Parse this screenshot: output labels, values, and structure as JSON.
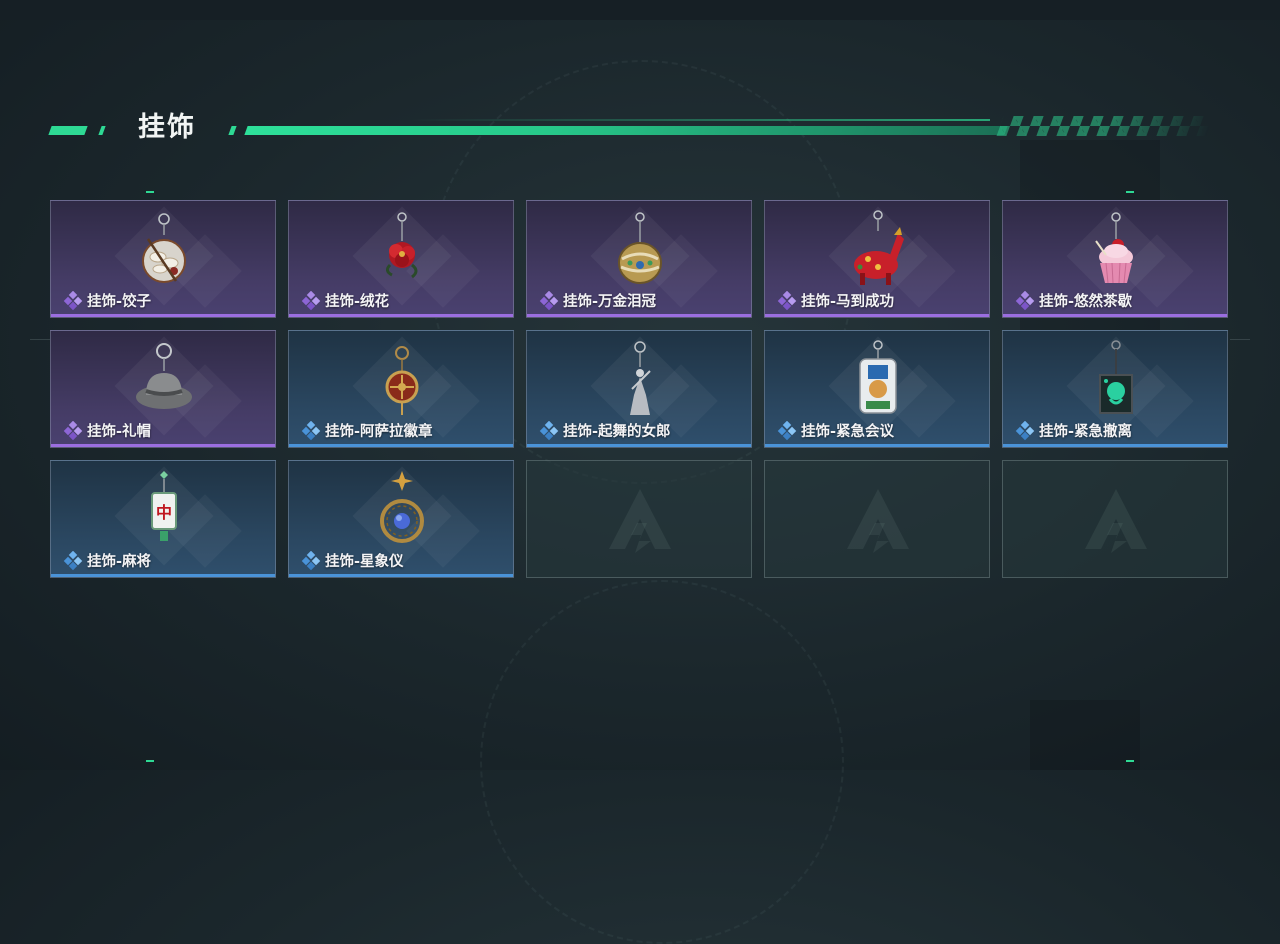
{
  "section": {
    "title": "挂饰"
  },
  "colors": {
    "accent": "#2ed994",
    "rarity_purple": "#9b6ee0",
    "rarity_blue": "#4a93d8"
  },
  "items": [
    {
      "label": "挂饰-饺子",
      "rarity": "purple",
      "icon": "dumpling-charm-icon"
    },
    {
      "label": "挂饰-绒花",
      "rarity": "purple",
      "icon": "velvet-flower-charm-icon"
    },
    {
      "label": "挂饰-万金泪冠",
      "rarity": "purple",
      "icon": "jeweled-crown-charm-icon"
    },
    {
      "label": "挂饰-马到成功",
      "rarity": "purple",
      "icon": "red-horse-charm-icon"
    },
    {
      "label": "挂饰-悠然茶歇",
      "rarity": "purple",
      "icon": "cupcake-charm-icon"
    },
    {
      "label": "挂饰-礼帽",
      "rarity": "purple",
      "icon": "fedora-hat-charm-icon"
    },
    {
      "label": "挂饰-阿萨拉徽章",
      "rarity": "blue",
      "icon": "badge-charm-icon"
    },
    {
      "label": "挂饰-起舞的女郎",
      "rarity": "blue",
      "icon": "dancer-figurine-charm-icon"
    },
    {
      "label": "挂饰-紧急会议",
      "rarity": "blue",
      "icon": "emergency-meeting-charm-icon"
    },
    {
      "label": "挂饰-紧急撤离",
      "rarity": "blue",
      "icon": "emergency-evac-charm-icon"
    },
    {
      "label": "挂饰-麻将",
      "rarity": "blue",
      "icon": "mahjong-tile-charm-icon"
    },
    {
      "label": "挂饰-星象仪",
      "rarity": "blue",
      "icon": "astrolabe-charm-icon"
    }
  ],
  "empty_slots": 3
}
